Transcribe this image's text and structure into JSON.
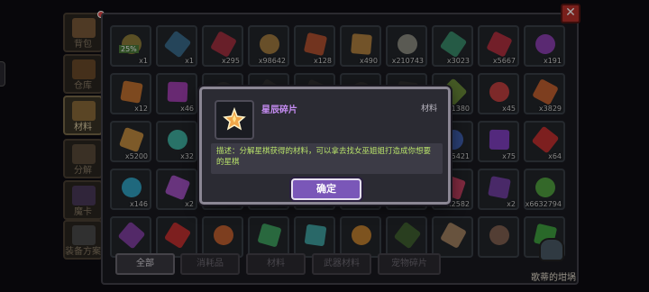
{
  "side_tabs": [
    {
      "label": "背包",
      "icon": "backpack-icon",
      "color": "#7a5a3a",
      "badge": true
    },
    {
      "label": "仓库",
      "icon": "warehouse-chest-icon",
      "color": "#6a4a2a"
    },
    {
      "label": "材料",
      "icon": "materials-icon",
      "color": "#8a6a3a",
      "active": true
    },
    {
      "label": "分解",
      "icon": "decompose-icon",
      "color": "#5a4a3a"
    },
    {
      "label": "魔卡",
      "icon": "magic-card-icon",
      "color": "#4a3a5a"
    },
    {
      "label": "装备方案",
      "icon": "equipment-plan-icon",
      "color": "#4a4a4a"
    }
  ],
  "close_label": "✕",
  "items": [
    {
      "qty": "x1",
      "color": "#8c7b3a",
      "tag": "25%"
    },
    {
      "qty": "x1",
      "color": "#3a6a8a"
    },
    {
      "qty": "x295",
      "color": "#a03040"
    },
    {
      "qty": "x98642",
      "color": "#a07a40"
    },
    {
      "qty": "x128",
      "color": "#b05030"
    },
    {
      "qty": "x490",
      "color": "#b08040"
    },
    {
      "qty": "x210743",
      "color": "#8a8a80"
    },
    {
      "qty": "x3023",
      "color": "#3a8a6a"
    },
    {
      "qty": "x5667",
      "color": "#b03040"
    },
    {
      "qty": "x191",
      "color": "#8a40b0"
    },
    {
      "qty": "x12",
      "color": "#c07030"
    },
    {
      "qty": "x46",
      "color": "#a040b0"
    },
    {
      "qty": "",
      "color": "#333"
    },
    {
      "qty": "",
      "color": "#333"
    },
    {
      "qty": "",
      "color": "#333"
    },
    {
      "qty": "",
      "color": "#333"
    },
    {
      "qty": "",
      "color": "#333"
    },
    {
      "qty": "x11380",
      "color": "#6a8a3a"
    },
    {
      "qty": "x45",
      "color": "#c04040"
    },
    {
      "qty": "x3829",
      "color": "#c06030"
    },
    {
      "qty": "x5200",
      "color": "#c08a40"
    },
    {
      "qty": "x32",
      "color": "#40b0a0"
    },
    {
      "qty": "",
      "color": "#333"
    },
    {
      "qty": "",
      "color": "#333"
    },
    {
      "qty": "",
      "color": "#333"
    },
    {
      "qty": "",
      "color": "#333"
    },
    {
      "qty": "",
      "color": "#333"
    },
    {
      "qty": "x15421",
      "color": "#4060b0"
    },
    {
      "qty": "x75",
      "color": "#8040c0"
    },
    {
      "qty": "x64",
      "color": "#c03030"
    },
    {
      "qty": "x146",
      "color": "#30a0c0"
    },
    {
      "qty": "x2",
      "color": "#a050c0"
    },
    {
      "qty": "x98",
      "color": "#c05030"
    },
    {
      "qty": "x1",
      "color": "#c0a040"
    },
    {
      "qty": "x2",
      "color": "#a040b0"
    },
    {
      "qty": "x338",
      "color": "#4080c0"
    },
    {
      "qty": "x83879",
      "color": "#508040"
    },
    {
      "qty": "x2582",
      "color": "#c04060"
    },
    {
      "qty": "x2",
      "color": "#7040a0"
    },
    {
      "qty": "x6632794",
      "color": "#50a040"
    },
    {
      "qty": "",
      "color": "#8040a0"
    },
    {
      "qty": "",
      "color": "#c03030"
    },
    {
      "qty": "",
      "color": "#c06030"
    },
    {
      "qty": "",
      "color": "#40a060"
    },
    {
      "qty": "",
      "color": "#40a0a0"
    },
    {
      "qty": "",
      "color": "#c08030"
    },
    {
      "qty": "",
      "color": "#406030"
    },
    {
      "qty": "",
      "color": "#a08060"
    },
    {
      "qty": "",
      "color": "#806050"
    },
    {
      "qty": "",
      "color": "#40a040"
    }
  ],
  "filters": [
    {
      "label": "全部",
      "active": true
    },
    {
      "label": "消耗品"
    },
    {
      "label": "材料"
    },
    {
      "label": "武器材料"
    },
    {
      "label": "宠物碎片"
    }
  ],
  "workshop": {
    "label": "歌蒂的坩埚",
    "icon": "cauldron-icon"
  },
  "dialog": {
    "title": "星辰碎片",
    "category": "材料",
    "item_icon": "star-shard-icon",
    "description": "描述：分解星棋获得的材料，可以拿去找女巫姐姐打造成你想要的星棋",
    "confirm_label": "确定"
  }
}
